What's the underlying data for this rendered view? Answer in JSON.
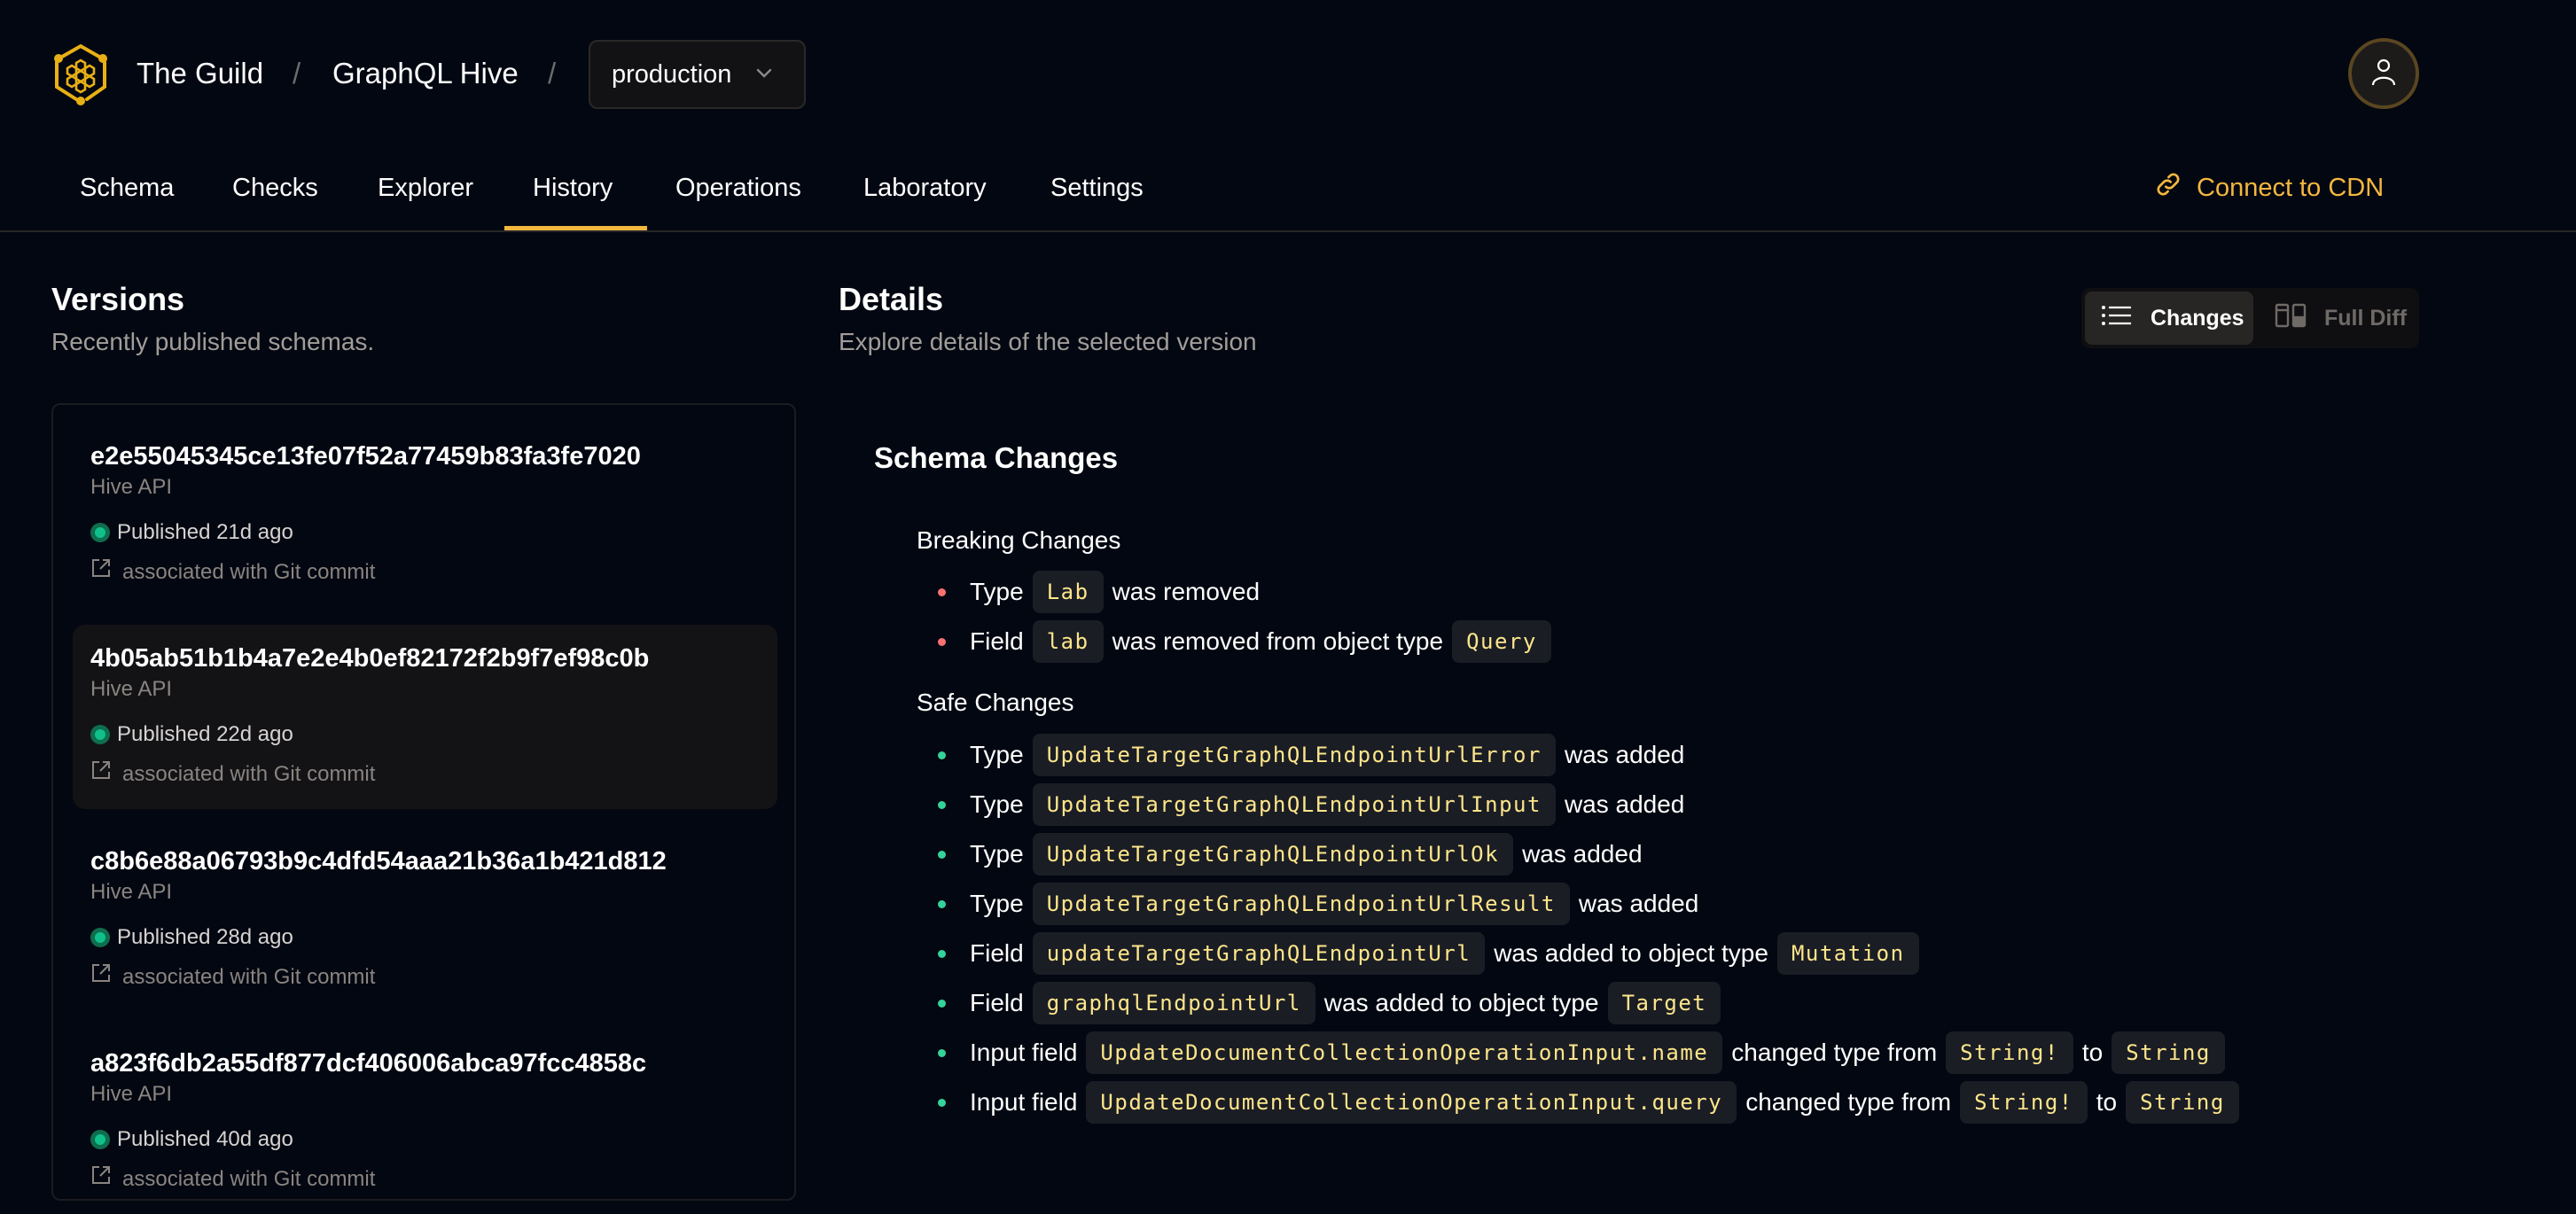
{
  "header": {
    "org": "The Guild",
    "project": "GraphQL Hive",
    "separator": "/",
    "environment": "production",
    "logo_icon": "hive-honeycomb-logo",
    "avatar_icon": "user-icon",
    "accent_color": "#f4b73e"
  },
  "nav": {
    "tabs": [
      {
        "label": "Schema",
        "active": false
      },
      {
        "label": "Checks",
        "active": false
      },
      {
        "label": "Explorer",
        "active": false
      },
      {
        "label": "History",
        "active": true
      },
      {
        "label": "Operations",
        "active": false
      },
      {
        "label": "Laboratory",
        "active": false
      },
      {
        "label": "Settings",
        "active": false
      }
    ],
    "cdn_link": "Connect to CDN"
  },
  "versions": {
    "title": "Versions",
    "subtitle": "Recently published schemas.",
    "items": [
      {
        "hash": "e2e55045345ce13fe07f52a77459b83fa3fe7020",
        "service": "Hive API",
        "status": "Published 21d ago",
        "git": "associated with Git commit",
        "selected": false
      },
      {
        "hash": "4b05ab51b1b4a7e2e4b0ef82172f2b9f7ef98c0b",
        "service": "Hive API",
        "status": "Published 22d ago",
        "git": "associated with Git commit",
        "selected": true
      },
      {
        "hash": "c8b6e88a06793b9c4dfd54aaa21b36a1b421d812",
        "service": "Hive API",
        "status": "Published 28d ago",
        "git": "associated with Git commit",
        "selected": false
      },
      {
        "hash": "a823f6db2a55df877dcf406006abca97fcc4858c",
        "service": "Hive API",
        "status": "Published 40d ago",
        "git": "associated with Git commit",
        "selected": false
      }
    ]
  },
  "details": {
    "title": "Details",
    "subtitle": "Explore details of the selected version",
    "view_toggle": {
      "changes": "Changes",
      "full_diff": "Full Diff",
      "active": "changes"
    },
    "schema_changes_title": "Schema Changes",
    "breaking_title": "Breaking Changes",
    "safe_title": "Safe Changes",
    "breaking": [
      {
        "parts": [
          {
            "t": "Type"
          },
          {
            "c": "Lab"
          },
          {
            "t": "was removed"
          }
        ]
      },
      {
        "parts": [
          {
            "t": "Field"
          },
          {
            "c": "lab"
          },
          {
            "t": "was removed from object type"
          },
          {
            "c": "Query"
          }
        ]
      }
    ],
    "safe": [
      {
        "parts": [
          {
            "t": "Type"
          },
          {
            "c": "UpdateTargetGraphQLEndpointUrlError"
          },
          {
            "t": "was added"
          }
        ]
      },
      {
        "parts": [
          {
            "t": "Type"
          },
          {
            "c": "UpdateTargetGraphQLEndpointUrlInput"
          },
          {
            "t": "was added"
          }
        ]
      },
      {
        "parts": [
          {
            "t": "Type"
          },
          {
            "c": "UpdateTargetGraphQLEndpointUrlOk"
          },
          {
            "t": "was added"
          }
        ]
      },
      {
        "parts": [
          {
            "t": "Type"
          },
          {
            "c": "UpdateTargetGraphQLEndpointUrlResult"
          },
          {
            "t": "was added"
          }
        ]
      },
      {
        "parts": [
          {
            "t": "Field"
          },
          {
            "c": "updateTargetGraphQLEndpointUrl"
          },
          {
            "t": "was added to object type"
          },
          {
            "c": "Mutation"
          }
        ]
      },
      {
        "parts": [
          {
            "t": "Field"
          },
          {
            "c": "graphqlEndpointUrl"
          },
          {
            "t": "was added to object type"
          },
          {
            "c": "Target"
          }
        ]
      },
      {
        "parts": [
          {
            "t": "Input field"
          },
          {
            "c": "UpdateDocumentCollectionOperationInput.name"
          },
          {
            "t": "changed type from"
          },
          {
            "c": "String!"
          },
          {
            "t": "to"
          },
          {
            "c": "String"
          }
        ]
      },
      {
        "parts": [
          {
            "t": "Input field"
          },
          {
            "c": "UpdateDocumentCollectionOperationInput.query"
          },
          {
            "t": "changed type from"
          },
          {
            "c": "String!"
          },
          {
            "t": "to"
          },
          {
            "c": "String"
          }
        ]
      }
    ],
    "colors": {
      "breaking_bullet": "#f87171",
      "safe_bullet": "#34d399",
      "code_text": "#fde68a",
      "code_bg": "#1b1d25"
    }
  }
}
